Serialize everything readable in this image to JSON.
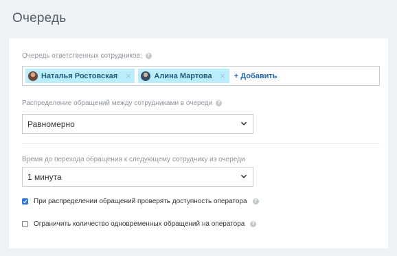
{
  "page": {
    "title": "Очередь"
  },
  "queue": {
    "label": "Очередь ответственных сотрудников:",
    "employees": [
      {
        "name": "Наталья Ростовская"
      },
      {
        "name": "Алина Мартова"
      }
    ],
    "remove_glyph": "×",
    "add_label": "+ Добавить"
  },
  "distribution": {
    "label": "Распределение обращений между сотрудниками в очереди",
    "value": "Равномерно"
  },
  "timeout": {
    "label": "Время до перехода обращения к следующему сотруднику из очереди",
    "value": "1 минута"
  },
  "options": {
    "check_availability": {
      "label": "При распределении обращений проверять доступность оператора",
      "checked": true
    },
    "limit_concurrent": {
      "label": "Ограничить количество одновременных обращений на оператора",
      "checked": false
    }
  },
  "help_glyph": "?",
  "colors": {
    "accent": "#2b74d8",
    "tag_bg": "#bcedfc",
    "link": "#2067b0"
  }
}
